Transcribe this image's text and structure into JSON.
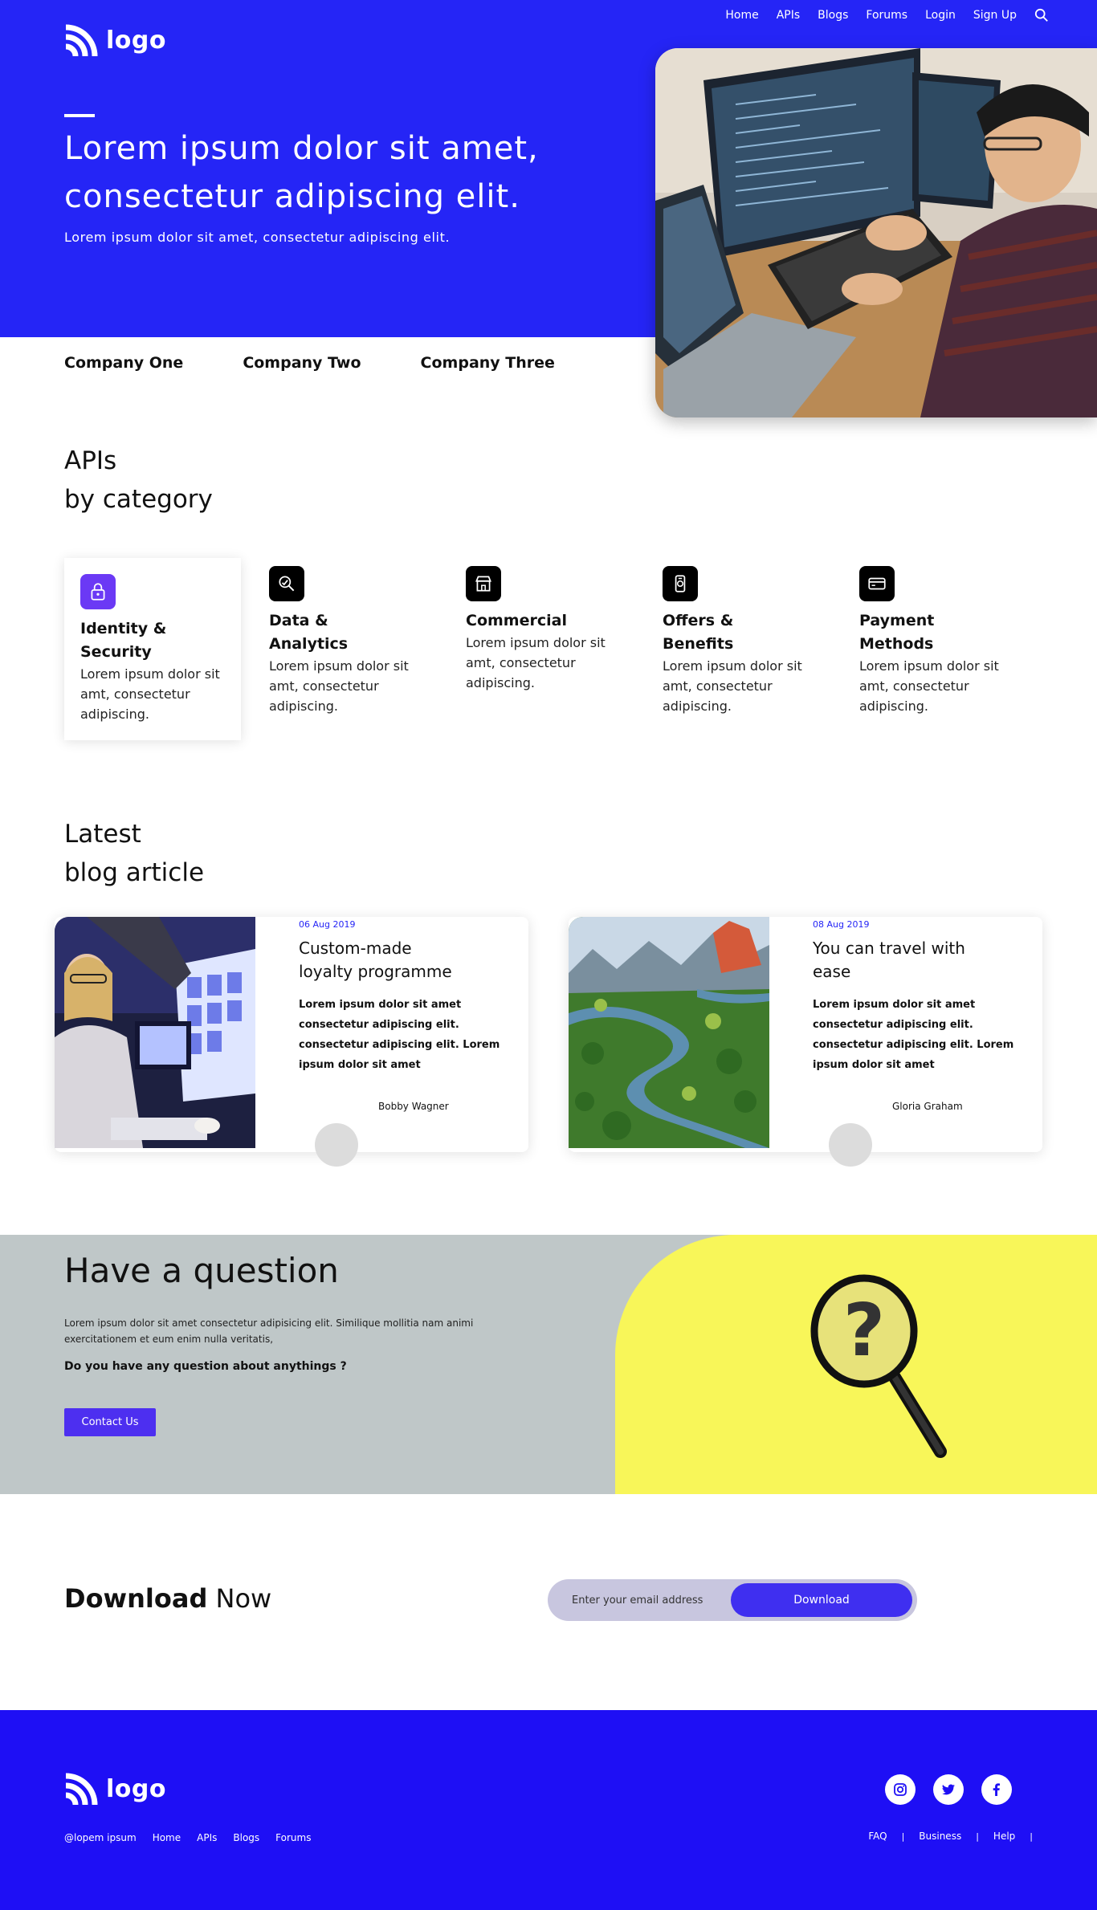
{
  "brand": {
    "logo_text": "logo"
  },
  "nav": {
    "items": [
      "Home",
      "APIs",
      "Blogs",
      "Forums",
      "Login",
      "Sign Up"
    ]
  },
  "hero": {
    "title": "Lorem ipsum dolor sit amet, consectetur adipiscing elit.",
    "subtitle": "Lorem ipsum dolor sit amet, consectetur adipiscing elit."
  },
  "companies": [
    "Company One",
    "Company Two",
    "Company Three"
  ],
  "apis": {
    "title_line1": "APIs",
    "title_line2": "by category",
    "categories": [
      {
        "title": "Identity & Security",
        "desc": "Lorem ipsum dolor sit amt, consectetur adipiscing.",
        "icon": "lock-icon"
      },
      {
        "title": "Data & Analytics",
        "desc": "Lorem ipsum dolor sit amt, consectetur adipiscing.",
        "icon": "analytics-icon"
      },
      {
        "title": "Commercial",
        "desc": "Lorem ipsum dolor sit amt, consectetur adipiscing.",
        "icon": "store-icon"
      },
      {
        "title": "Offers & Benefits",
        "desc": "Lorem ipsum dolor sit amt, consectetur adipiscing.",
        "icon": "gift-icon"
      },
      {
        "title": "Payment Methods",
        "desc": "Lorem ipsum dolor sit amt, consectetur adipiscing.",
        "icon": "card-icon"
      }
    ]
  },
  "blog": {
    "title_line1": "Latest",
    "title_line2": "blog article",
    "articles": [
      {
        "date": "06 Aug 2019",
        "title": "Custom-made loyalty programme",
        "body": "Lorem ipsum dolor sit amet consectetur adipiscing elit. consectetur adipiscing elit. Lorem ipsum dolor sit amet",
        "author": "Bobby Wagner"
      },
      {
        "date": "08 Aug 2019",
        "title": "You can travel with ease",
        "body": "Lorem ipsum dolor sit amet consectetur adipiscing elit. consectetur adipiscing elit. Lorem ipsum dolor sit amet",
        "author": "Gloria Graham"
      }
    ]
  },
  "question": {
    "title": "Have a question",
    "paragraph": "Lorem ipsum dolor sit amet consectetur adipisicing elit. Similique mollitia nam animi exercitationem et eum enim nulla veritatis,",
    "prompt": "Do you have any question about anythings ?",
    "button": "Contact Us"
  },
  "download": {
    "title_bold": "Download",
    "title_rest": " Now",
    "placeholder": "Enter your email address",
    "button": "Download"
  },
  "footer": {
    "copyright": "@lopem ipsum",
    "links": [
      "Home",
      "APIs",
      "Blogs",
      "Forums"
    ],
    "right_links": [
      "FAQ",
      "Business",
      "Help"
    ],
    "social": [
      "instagram-icon",
      "twitter-icon",
      "facebook-icon"
    ]
  }
}
